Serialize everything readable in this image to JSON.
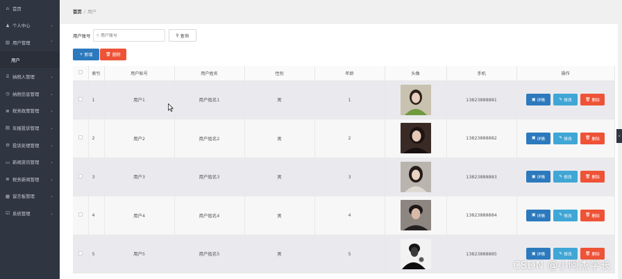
{
  "sidebar": {
    "items": [
      {
        "label": "首页",
        "icon": "home-icon",
        "glyph": "⌂",
        "arrow": false
      },
      {
        "label": "个人中心",
        "icon": "user-icon",
        "glyph": "♟",
        "arrow": true
      },
      {
        "label": "用户管理",
        "icon": "chart-icon",
        "glyph": "▥",
        "arrow": true
      },
      {
        "label": "用户",
        "icon": "",
        "glyph": "",
        "arrow": false,
        "sub": true
      },
      {
        "label": "纳税人管理",
        "icon": "bank-icon",
        "glyph": "⌸",
        "arrow": true
      },
      {
        "label": "纳税信息管理",
        "icon": "clock-icon",
        "glyph": "◷",
        "arrow": true
      },
      {
        "label": "税务政策管理",
        "icon": "list-icon",
        "glyph": "≣",
        "arrow": true
      },
      {
        "label": "年报投诉管理",
        "icon": "report-icon",
        "glyph": "▤",
        "arrow": true
      },
      {
        "label": "投诉处理管理",
        "icon": "process-icon",
        "glyph": "⚙",
        "arrow": true
      },
      {
        "label": "新闻资讯管理",
        "icon": "message-icon",
        "glyph": "▭",
        "arrow": true
      },
      {
        "label": "税务新闻管理",
        "icon": "news-icon",
        "glyph": "≣",
        "arrow": true
      },
      {
        "label": "留言板管理",
        "icon": "board-icon",
        "glyph": "▦",
        "arrow": true
      },
      {
        "label": "系统管理",
        "icon": "system-icon",
        "glyph": "☑",
        "arrow": true
      }
    ]
  },
  "breadcrumb": {
    "home": "首页",
    "sep": "/",
    "current": "用户"
  },
  "search": {
    "label": "用户账号",
    "placeholder": "用户账号",
    "button": "查询"
  },
  "actions": {
    "add": "新增",
    "delete": "删除"
  },
  "table": {
    "headers": [
      "",
      "索引",
      "用户账号",
      "用户姓名",
      "性别",
      "年龄",
      "头像",
      "手机",
      "操作"
    ],
    "rows": [
      {
        "index": "1",
        "account": "用户1",
        "name": "用户姓名1",
        "gender": "男",
        "age": "1",
        "phone": "13823888881"
      },
      {
        "index": "2",
        "account": "用户2",
        "name": "用户姓名2",
        "gender": "男",
        "age": "2",
        "phone": "13823888882"
      },
      {
        "index": "3",
        "account": "用户3",
        "name": "用户姓名3",
        "gender": "男",
        "age": "3",
        "phone": "13823888883"
      },
      {
        "index": "4",
        "account": "用户4",
        "name": "用户姓名4",
        "gender": "男",
        "age": "4",
        "phone": "13823888884"
      },
      {
        "index": "5",
        "account": "用户5",
        "name": "用户姓名5",
        "gender": "男",
        "age": "5",
        "phone": "13823888885"
      }
    ],
    "row_actions": {
      "detail": "详情",
      "edit": "修改",
      "delete": "删除"
    }
  },
  "colors": {
    "sidebar_bg": "#2f3541",
    "primary": "#2c79bd",
    "info": "#3fa6d6",
    "danger": "#ee5337"
  },
  "watermark": "CSDN @小阿杰学长"
}
